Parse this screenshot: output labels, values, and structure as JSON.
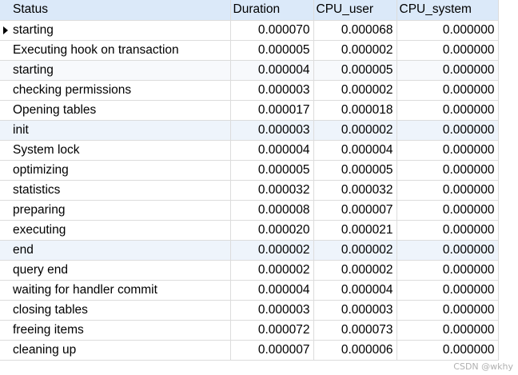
{
  "grid": {
    "columns": [
      "Status",
      "Duration",
      "CPU_user",
      "CPU_system"
    ],
    "rows": [
      [
        "starting",
        "0.000070",
        "0.000068",
        "0.000000"
      ],
      [
        "Executing hook on transaction",
        "0.000005",
        "0.000002",
        "0.000000"
      ],
      [
        "starting",
        "0.000004",
        "0.000005",
        "0.000000"
      ],
      [
        "checking permissions",
        "0.000003",
        "0.000002",
        "0.000000"
      ],
      [
        "Opening tables",
        "0.000017",
        "0.000018",
        "0.000000"
      ],
      [
        "init",
        "0.000003",
        "0.000002",
        "0.000000"
      ],
      [
        "System lock",
        "0.000004",
        "0.000004",
        "0.000000"
      ],
      [
        "optimizing",
        "0.000005",
        "0.000005",
        "0.000000"
      ],
      [
        "statistics",
        "0.000032",
        "0.000032",
        "0.000000"
      ],
      [
        "preparing",
        "0.000008",
        "0.000007",
        "0.000000"
      ],
      [
        "executing",
        "0.000020",
        "0.000021",
        "0.000000"
      ],
      [
        "end",
        "0.000002",
        "0.000002",
        "0.000000"
      ],
      [
        "query end",
        "0.000002",
        "0.000002",
        "0.000000"
      ],
      [
        "waiting for handler commit",
        "0.000004",
        "0.000004",
        "0.000000"
      ],
      [
        "closing tables",
        "0.000003",
        "0.000003",
        "0.000000"
      ],
      [
        "freeing items",
        "0.000072",
        "0.000073",
        "0.000000"
      ],
      [
        "cleaning up",
        "0.000007",
        "0.000006",
        "0.000000"
      ]
    ]
  },
  "watermark": "CSDN @wkhy"
}
